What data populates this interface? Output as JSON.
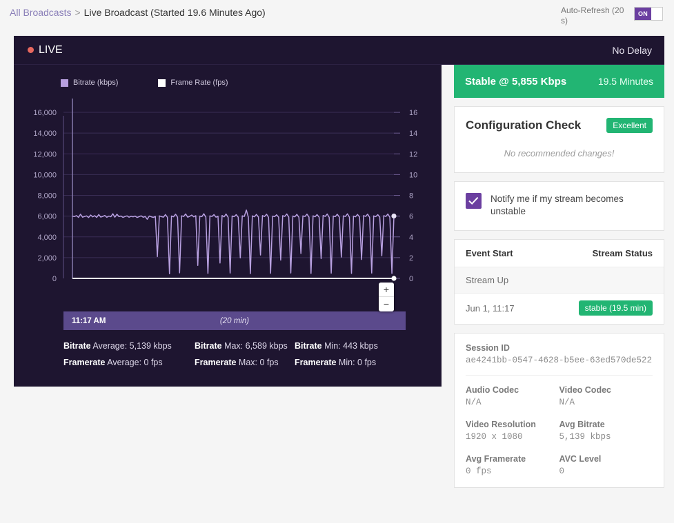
{
  "breadcrumb": {
    "root": "All Broadcasts",
    "separator": ">",
    "current": "Live Broadcast (Started 19.6 Minutes Ago)"
  },
  "auto_refresh": {
    "label": "Auto-Refresh (20 s)",
    "toggle_state": "ON"
  },
  "live_bar": {
    "live_label": "LIVE",
    "delay_label": "No Delay",
    "dot_color": "#e8685f"
  },
  "chart_panel": {
    "slider": {
      "time": "11:17 AM",
      "duration": "(20 min)"
    },
    "zoom_in": "+",
    "zoom_out": "−",
    "stats": [
      [
        {
          "label": "Bitrate",
          "rest": " Average: 5,139 kbps"
        },
        {
          "label": "Bitrate",
          "rest": " Max: 6,589 kbps"
        },
        {
          "label": "Bitrate",
          "rest": " Min: 443 kbps"
        }
      ],
      [
        {
          "label": "Framerate",
          "rest": " Average: 0 fps"
        },
        {
          "label": "Framerate",
          "rest": " Max: 0 fps"
        },
        {
          "label": "Framerate",
          "rest": " Min: 0 fps"
        }
      ]
    ]
  },
  "chart_data": {
    "type": "line",
    "title": "",
    "xlabel": "",
    "ylabel": "Bitrate (kbps)",
    "y2label": "Frame Rate (fps)",
    "grid": true,
    "legend_position": "top-left",
    "background": "#1e1530",
    "ylim": [
      0,
      17000
    ],
    "y2lim": [
      0,
      17
    ],
    "yticks": [
      0,
      2000,
      4000,
      6000,
      8000,
      10000,
      12000,
      14000,
      16000
    ],
    "ytick_labels": [
      "0",
      "2,000",
      "4,000",
      "6,000",
      "8,000",
      "10,000",
      "12,000",
      "14,000",
      "16,000"
    ],
    "y2ticks": [
      0,
      2,
      4,
      6,
      8,
      10,
      12,
      14,
      16
    ],
    "y2tick_labels": [
      "0",
      "2",
      "4",
      "6",
      "8",
      "10",
      "12",
      "14",
      "16"
    ],
    "x_start": "11:17 AM",
    "x_duration_min": 20,
    "series": [
      {
        "name": "Bitrate (kbps)",
        "color": "#b8a0e0",
        "axis": "left",
        "values": [
          5990,
          5960,
          6050,
          5880,
          6180,
          5900,
          5960,
          6020,
          5870,
          6100,
          5930,
          6040,
          5880,
          6150,
          5910,
          5970,
          6060,
          5890,
          6000,
          5940,
          6230,
          5900,
          6180,
          5950,
          6010,
          5880,
          5960,
          6020,
          5900,
          5980,
          5930,
          6000,
          5870,
          5950,
          6030,
          5890,
          5960,
          5700,
          6010,
          5940,
          5880,
          5960,
          2100,
          6020,
          5950,
          5900,
          6150,
          5880,
          443,
          6010,
          5940,
          6180,
          5890,
          530,
          6030,
          5960,
          6210,
          5900,
          5980,
          6100,
          5930,
          6040,
          1250,
          6000,
          5950,
          6230,
          5890,
          480,
          6020,
          5960,
          6150,
          5900,
          5990,
          1480,
          6060,
          5930,
          6200,
          5880,
          510,
          6010,
          5950,
          6140,
          5900,
          1980,
          6030,
          5970,
          6589,
          5890,
          460,
          6020,
          5940,
          6160,
          5910,
          2250,
          6050,
          5960,
          6180,
          5880,
          490,
          6000,
          5950,
          6130,
          5890,
          1760,
          6040,
          5970,
          6210,
          5900,
          520,
          6010,
          5930,
          6170,
          5880,
          2400,
          6020,
          5960,
          6190,
          5900,
          470,
          6030,
          5940,
          6150,
          5890,
          1900,
          6060,
          5970,
          6200,
          5880,
          500,
          6010,
          5950,
          6180,
          5900,
          2050,
          6030,
          5960,
          6220,
          5890,
          480,
          6000,
          5940,
          6160,
          5910,
          1820,
          6050,
          5970,
          6190,
          5880,
          510,
          6020,
          5950,
          6140,
          5900,
          2180,
          6040,
          5960,
          6200,
          5890,
          470,
          6010
        ]
      },
      {
        "name": "Frame Rate (fps)",
        "color": "#ffffff",
        "axis": "right",
        "values": [
          0,
          0,
          0,
          0,
          0,
          0,
          0,
          0,
          0,
          0,
          0,
          0,
          0,
          0,
          0,
          0,
          0,
          0,
          0,
          0
        ]
      }
    ],
    "summary": {
      "bitrate_avg": 5139,
      "bitrate_max": 6589,
      "bitrate_min": 443,
      "framerate_avg": 0,
      "framerate_max": 0,
      "framerate_min": 0,
      "units_bitrate": "kbps",
      "units_framerate": "fps"
    }
  },
  "status_banner": {
    "text": "Stable @ 5,855 Kbps",
    "minutes": "19.5 Minutes",
    "color": "#22b573"
  },
  "configuration_check": {
    "title": "Configuration Check",
    "badge": "Excellent",
    "message": "No recommended changes!"
  },
  "notify": {
    "label": "Notify me if my stream becomes unstable",
    "checked": true
  },
  "events_table": {
    "columns": [
      "Event Start",
      "Stream Status"
    ],
    "group_label": "Stream Up",
    "rows": [
      {
        "start": "Jun 1, 11:17",
        "status": "stable (19.5 min)"
      }
    ]
  },
  "session": {
    "label": "Session ID",
    "value": "ae4241bb-0547-4628-b5ee-63ed570de522"
  },
  "details": [
    {
      "label": "Audio Codec",
      "value": "N/A"
    },
    {
      "label": "Video Codec",
      "value": "N/A"
    },
    {
      "label": "Video Resolution",
      "value": "1920 x 1080"
    },
    {
      "label": "Avg Bitrate",
      "value": "5,139 kbps"
    },
    {
      "label": "Avg Framerate",
      "value": "0 fps"
    },
    {
      "label": "AVC Level",
      "value": "0"
    }
  ]
}
